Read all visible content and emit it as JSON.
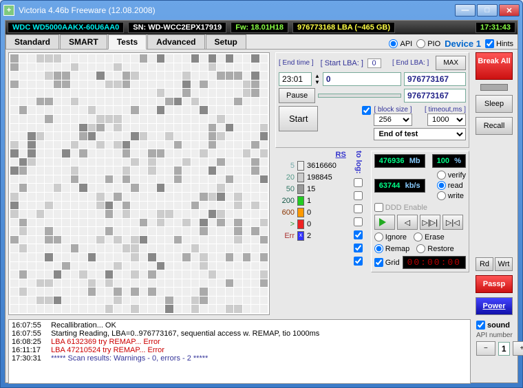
{
  "window": {
    "title": "Victoria 4.46b Freeware (12.08.2008)"
  },
  "status": {
    "model": "WDC WD5000AAKX-60U6AA0",
    "sn_label": "SN:",
    "sn": "WD-WCC2EPX17919",
    "fw_label": "Fw:",
    "fw": "18.01H18",
    "lba": "976773168 LBA (~465 GB)",
    "clock": "17:31:43"
  },
  "tabs": {
    "standard": "Standard",
    "smart": "SMART",
    "tests": "Tests",
    "advanced": "Advanced",
    "setup": "Setup"
  },
  "opts": {
    "api": "API",
    "pio": "PIO",
    "device": "Device 1",
    "hints": "Hints"
  },
  "scan": {
    "endtime_lbl": "[ End time ]",
    "endtime": "23:01",
    "startlba_lbl": "[ Start LBA: ]",
    "startlba_cur": "0",
    "endlba_lbl": "[ End LBA: ]",
    "max": "MAX",
    "startlba": "0",
    "endlba": "976773167",
    "pause": "Pause",
    "lba2": "976773167",
    "start": "Start",
    "block_lbl": "[ block size ]",
    "block": "256",
    "timeout_lbl": "[ timeout,ms ]",
    "timeout": "1000",
    "eot": "End of test"
  },
  "legend": {
    "rs": "RS",
    "tolog": "to log:",
    "t5": "5",
    "v5": "3616660",
    "t20": "20",
    "v20": "198845",
    "t50": "50",
    "v50": "15",
    "t200": "200",
    "v200": "1",
    "t600": "600",
    "v600": "0",
    "tgt": ">",
    "vgt": "0",
    "terr": "Err",
    "verr": "2"
  },
  "stats": {
    "pos": "476936",
    "pos_u": "Mb",
    "spd": "63744",
    "spd_u": "kb/s",
    "ddd": "DDD Enable",
    "pct": "100",
    "pct_u": "%",
    "verify": "verify",
    "read": "read",
    "write": "write",
    "ignore": "Ignore",
    "erase": "Erase",
    "remap": "Remap",
    "restore": "Restore",
    "grid": "Grid",
    "timer": "00:00:00"
  },
  "rcol": {
    "break": "Break All",
    "sleep": "Sleep",
    "recall": "Recall",
    "rd": "Rd",
    "wrt": "Wrt",
    "passp": "Passp",
    "power": "Power",
    "sound": "sound",
    "api_num_lbl": "API number",
    "api_num": "1"
  },
  "log": [
    {
      "ts": "16:07:55",
      "cls": "",
      "msg": "Recallibration... OK"
    },
    {
      "ts": "16:07:55",
      "cls": "",
      "msg": "Starting Reading, LBA=0..976773167, sequential access w. REMAP, tio 1000ms"
    },
    {
      "ts": "16:08:25",
      "cls": "err",
      "msg": "LBA 6132369 try REMAP... Error"
    },
    {
      "ts": "16:11:17",
      "cls": "err",
      "msg": "LBA 47210524 try REMAP... Error"
    },
    {
      "ts": "17:30:31",
      "cls": "info",
      "msg": "***** Scan results: Warnings - 0, errors - 2 *****"
    }
  ]
}
